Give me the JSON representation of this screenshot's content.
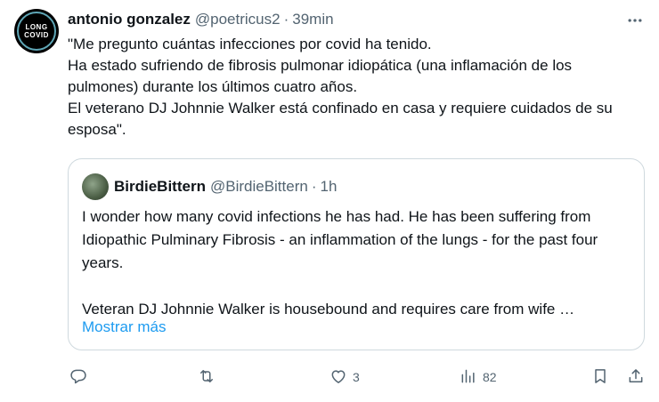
{
  "tweet": {
    "author_name": "antonio gonzalez",
    "author_handle": "@poetricus2",
    "separator": "·",
    "time": "39min",
    "avatar_text_line1": "LONG",
    "avatar_text_line2": "COVID",
    "text": "\"Me pregunto cuántas infecciones por covid ha tenido.\nHa estado sufriendo de fibrosis pulmonar idiopática (una inflamación de los pulmones) durante los últimos cuatro años.\nEl veterano DJ Johnnie Walker está confinado en casa y requiere cuidados de su esposa\"."
  },
  "quote": {
    "author_name": "BirdieBittern",
    "author_handle": "@BirdieBittern",
    "separator": "·",
    "time": "1h",
    "text": "I wonder how many covid infections he has had. He has been suffering from Idiopathic Pulminary Fibrosis - an inflammation of the lungs - for the past four years.\n\nVeteran DJ Johnnie Walker is housebound and requires care from wife …",
    "show_more": "Mostrar más"
  },
  "actions": {
    "reply_count": "",
    "retweet_count": "",
    "like_count": "3",
    "views_count": "82"
  },
  "icons": [
    "more-icon",
    "reply-icon",
    "retweet-icon",
    "like-icon",
    "views-icon",
    "bookmark-icon",
    "share-icon"
  ],
  "colors": {
    "link": "#1d9bf0",
    "secondary_text": "#536471",
    "border": "#cfd9de"
  }
}
